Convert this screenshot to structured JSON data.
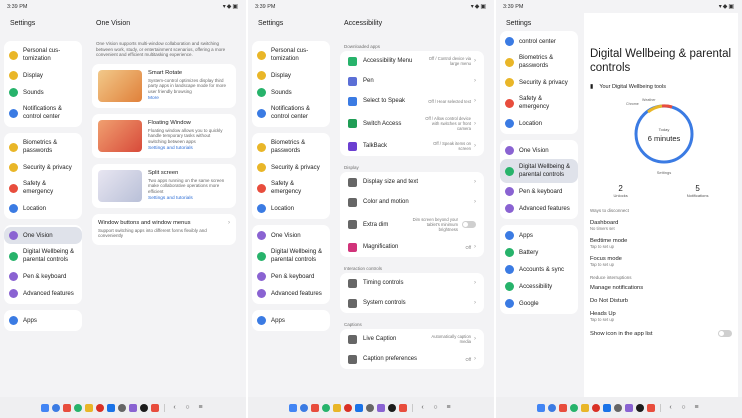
{
  "statusbar": {
    "time": "3:39 PM",
    "icons": "▾◆▣"
  },
  "left_nav": {
    "title": "Settings",
    "items": [
      {
        "label": "Personal cus-tomization",
        "icon": "palette-icon",
        "color": "#e9b628"
      },
      {
        "label": "Display",
        "icon": "sun-icon",
        "color": "#e9b628"
      },
      {
        "label": "Sounds",
        "icon": "speaker-icon",
        "color": "#27b36b"
      },
      {
        "label": "Notifications & control center",
        "icon": "bell-icon",
        "color": "#3b7be3"
      },
      {
        "label": "Biometrics & passwords",
        "icon": "fingerprint-icon",
        "color": "#e9b628"
      },
      {
        "label": "Security & privacy",
        "icon": "shield-icon",
        "color": "#e9b628"
      },
      {
        "label": "Safety & emergency",
        "icon": "asterisk-icon",
        "color": "#e84d3d"
      },
      {
        "label": "Location",
        "icon": "pin-icon",
        "color": "#3b7be3"
      },
      {
        "label": "One Vision",
        "icon": "layers-icon",
        "color": "#8a63d2"
      },
      {
        "label": "Digital Wellbeing & parental controls",
        "icon": "leaf-icon",
        "color": "#27b36b"
      },
      {
        "label": "Pen & keyboard",
        "icon": "pen-icon",
        "color": "#8a63d2"
      },
      {
        "label": "Advanced features",
        "icon": "star-icon",
        "color": "#8a63d2"
      },
      {
        "label": "Apps",
        "icon": "grid-icon",
        "color": "#3b7be3"
      }
    ],
    "third_items": [
      {
        "label": "control center",
        "icon": "bell-icon",
        "color": "#3b7be3"
      },
      {
        "label": "Biometrics & passwords",
        "icon": "fingerprint-icon",
        "color": "#e9b628"
      },
      {
        "label": "Security & privacy",
        "icon": "shield-icon",
        "color": "#e9b628"
      },
      {
        "label": "Safety & emergency",
        "icon": "asterisk-icon",
        "color": "#e84d3d"
      },
      {
        "label": "Location",
        "icon": "pin-icon",
        "color": "#3b7be3"
      },
      {
        "label": "One Vision",
        "icon": "layers-icon",
        "color": "#8a63d2"
      },
      {
        "label": "Digital Wellbeing & parental controls",
        "icon": "leaf-icon",
        "color": "#27b36b"
      },
      {
        "label": "Pen & keyboard",
        "icon": "pen-icon",
        "color": "#8a63d2"
      },
      {
        "label": "Advanced features",
        "icon": "star-icon",
        "color": "#8a63d2"
      },
      {
        "label": "Apps",
        "icon": "grid-icon",
        "color": "#3b7be3"
      },
      {
        "label": "Battery",
        "icon": "battery-icon",
        "color": "#27b36b"
      },
      {
        "label": "Accounts & sync",
        "icon": "person-icon",
        "color": "#3b7be3"
      },
      {
        "label": "Accessibility",
        "icon": "accessibility-icon",
        "color": "#27b36b"
      },
      {
        "label": "Google",
        "icon": "google-icon",
        "color": "#3b7be3"
      }
    ]
  },
  "one_vision": {
    "title": "One Vision",
    "description": "One Vision supports multi-window collaboration and switching between work, study, or entertainment scenarios, offering a more convenient and efficient multitasking experience.",
    "features": [
      {
        "title": "Smart Rotate",
        "desc": "System-control optimizes display third party apps in landscape mode for more user friendly browsing",
        "link": "More"
      },
      {
        "title": "Floating Window",
        "desc": "Floating window allows you to quickly handle temporary tasks without switching between apps",
        "link": "Settings and tutorials"
      },
      {
        "title": "Split screen",
        "desc": "Two apps running on the same screen make collaborative operations more efficient",
        "link": "Settings and tutorials"
      }
    ],
    "extra": {
      "title": "Window buttons and window menus",
      "desc": "Support switching apps into different forms flexibly and conveniently"
    }
  },
  "accessibility": {
    "title": "Accessibility",
    "sections": [
      {
        "header": "Downloaded apps",
        "items": [
          {
            "label": "Accessibility Menu",
            "sub": "Off / Control device via large menu",
            "color": "#27b36b"
          },
          {
            "label": "Pen",
            "sub": "",
            "color": "#5b6fd6"
          },
          {
            "label": "Select to Speak",
            "sub": "Off / Hear selected text",
            "color": "#3b7be3"
          },
          {
            "label": "Switch Access",
            "sub": "Off / Allow control device with switches or front camera",
            "color": "#1f9d55"
          },
          {
            "label": "TalkBack",
            "sub": "Off / Speak items on screen",
            "color": "#6b3fd1"
          }
        ]
      },
      {
        "header": "Display",
        "items": [
          {
            "label": "Display size and text",
            "sub": "",
            "color": "#666666"
          },
          {
            "label": "Color and motion",
            "sub": "",
            "color": "#666666"
          },
          {
            "label": "Extra dim",
            "sub": "Dim screen beyond your tablet's minimum brightness",
            "color": "#666666",
            "toggle": true
          },
          {
            "label": "Magnification",
            "sub": "Off",
            "color": "#d1337a"
          }
        ]
      },
      {
        "header": "Interaction controls",
        "items": [
          {
            "label": "Timing controls",
            "sub": "",
            "color": "#666666"
          },
          {
            "label": "System controls",
            "sub": "",
            "color": "#666666"
          }
        ]
      },
      {
        "header": "Captions",
        "items": [
          {
            "label": "Live Caption",
            "sub": "Automatically caption media",
            "color": "#666666"
          },
          {
            "label": "Caption preferences",
            "sub": "Off",
            "color": "#666666"
          }
        ]
      }
    ]
  },
  "wellbeing": {
    "title": "Digital Wellbeing & parental controls",
    "tools_label": "Your Digital Wellbeing tools",
    "ring_labels": [
      "Weather",
      "Chrome"
    ],
    "today": "Today",
    "minutes": "6 minutes",
    "settings_label": "Settings",
    "stats": [
      {
        "value": "2",
        "label": "Unlocks"
      },
      {
        "value": "5",
        "label": "Notifications"
      }
    ],
    "disconnect_header": "Ways to disconnect",
    "disconnect_items": [
      {
        "label": "Dashboard",
        "sub": "No timers set"
      },
      {
        "label": "Bedtime mode",
        "sub": "Tap to set up"
      },
      {
        "label": "Focus mode",
        "sub": "Tap to set up"
      }
    ],
    "interruptions_header": "Reduce interruptions",
    "interrupt_items": [
      {
        "label": "Manage notifications",
        "sub": ""
      },
      {
        "label": "Do Not Disturb",
        "sub": ""
      },
      {
        "label": "Heads Up",
        "sub": "Tap to set up"
      }
    ],
    "show_icon": "Show icon in the app list"
  },
  "dock_colors": [
    "#4285f4",
    "#3b7be3",
    "#e84d3d",
    "#27b36b",
    "#e9b628",
    "#d93025",
    "#1a73e8",
    "#666666",
    "#8a63d2",
    "#1c1c1c",
    "#e84d3d"
  ]
}
